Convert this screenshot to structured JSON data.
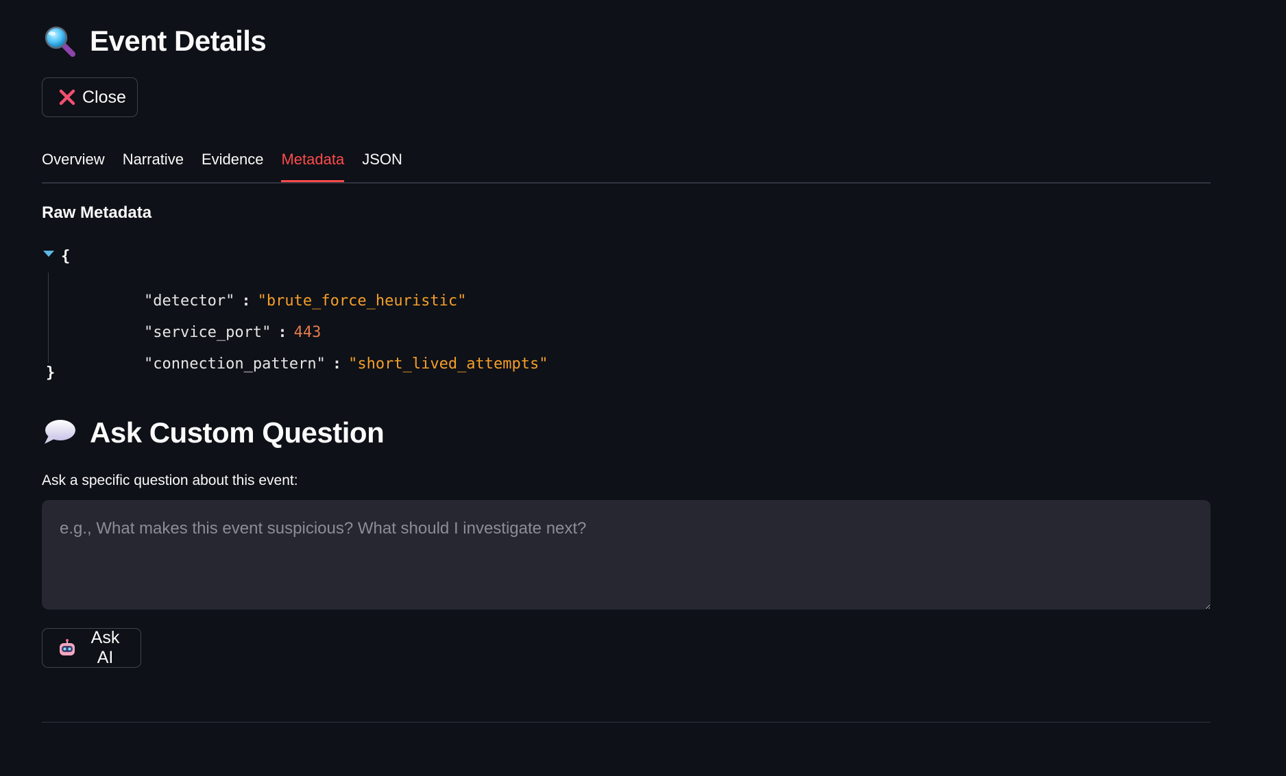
{
  "header": {
    "title": "Event Details",
    "icon": "magnifying-glass-icon",
    "close_label": "Close",
    "close_icon": "cross-mark-icon"
  },
  "tabs": [
    {
      "label": "Overview",
      "active": false
    },
    {
      "label": "Narrative",
      "active": false
    },
    {
      "label": "Evidence",
      "active": false
    },
    {
      "label": "Metadata",
      "active": true
    },
    {
      "label": "JSON",
      "active": false
    }
  ],
  "metadata": {
    "heading": "Raw Metadata",
    "open_brace": "{",
    "close_brace": "}",
    "entries": [
      {
        "key": "\"detector\"",
        "sep": ":",
        "value": "\"brute_force_heuristic\""
      },
      {
        "key": "\"service_port\"",
        "sep": ":",
        "value": "443"
      },
      {
        "key": "\"connection_pattern\"",
        "sep": ":",
        "value": "\"short_lived_attempts\""
      }
    ]
  },
  "ask": {
    "heading": "Ask Custom Question",
    "icon": "speech-bubble-icon",
    "label": "Ask a specific question about this event:",
    "placeholder": "e.g., What makes this event suspicious? What should I investigate next?",
    "button_label": "Ask AI",
    "button_icon": "robot-icon"
  },
  "colors": {
    "background": "#0e1117",
    "accent": "#ff4b4b",
    "json_string": "#f59e2a",
    "json_number": "#e37b4d",
    "input_bg": "#262730"
  }
}
